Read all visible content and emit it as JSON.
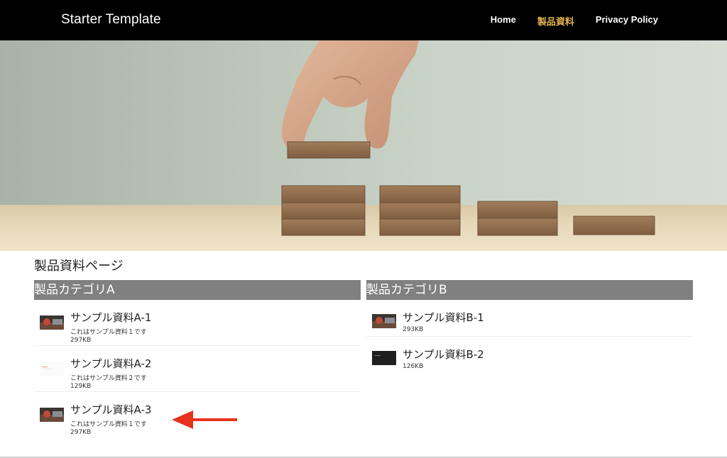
{
  "navbar": {
    "brand": "Starter Template",
    "links": [
      {
        "label": "Home",
        "active": false
      },
      {
        "label": "製品資料",
        "active": true
      },
      {
        "label": "Privacy Policy",
        "active": false
      }
    ],
    "active_color": "#e2b34c"
  },
  "hero": {
    "image": "hand stacking wooden blocks"
  },
  "page": {
    "title": "製品資料ページ"
  },
  "categories": [
    {
      "name": "製品カテゴリA",
      "items": [
        {
          "title": "サンプル資料A-1",
          "description": "これはサンプル資料１です",
          "size": "297KB",
          "thumb": "photo-thumb"
        },
        {
          "title": "サンプル資料A-2",
          "description": "これはサンプル資料２です",
          "size": "129KB",
          "thumb": "document-thumb"
        },
        {
          "title": "サンプル資料A-3",
          "description": "これはサンプル資料１です",
          "size": "297KB",
          "thumb": "photo-thumb"
        }
      ]
    },
    {
      "name": "製品カテゴリB",
      "items": [
        {
          "title": "サンプル資料B-1",
          "size": "293KB",
          "thumb": "photo-thumb"
        },
        {
          "title": "サンプル資料B-2",
          "size": "126KB",
          "thumb": "dark-slide-thumb"
        }
      ]
    }
  ],
  "annotation": {
    "icon": "red-arrow-left-icon",
    "color": "#e8321c"
  }
}
